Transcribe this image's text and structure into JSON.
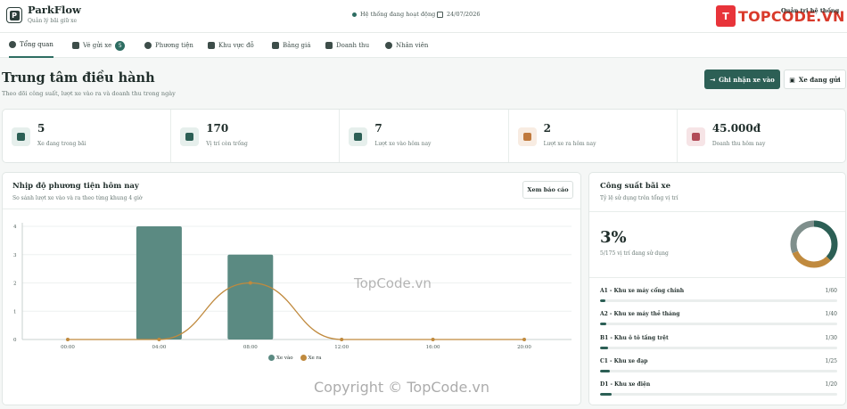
{
  "header": {
    "app_name": "ParkFlow",
    "app_sub": "Quản lý bãi giữ xe",
    "logo_letter": "P",
    "status": "Hệ thống đang hoạt động",
    "date": "24/07/2026",
    "admin": "Quản trị hệ thống",
    "watermark_brand": "TOPCODE.VN"
  },
  "nav": {
    "tabs": [
      {
        "label": "Tổng quan"
      },
      {
        "label": "Vé gửi xe",
        "badge": "5"
      },
      {
        "label": "Phương tiện"
      },
      {
        "label": "Khu vực đỗ"
      },
      {
        "label": "Bảng giá"
      },
      {
        "label": "Doanh thu"
      },
      {
        "label": "Nhân viên"
      }
    ]
  },
  "page": {
    "title": "Trung tâm điều hành",
    "subtitle": "Theo dõi công suất, lượt xe vào ra và doanh thu trong ngày",
    "primary_button": "Ghi nhận xe vào",
    "secondary_button": "Xe đang gửi"
  },
  "stats": [
    {
      "value": "5",
      "label": "Xe đang trong bãi"
    },
    {
      "value": "170",
      "label": "Vị trí còn trống"
    },
    {
      "value": "7",
      "label": "Lượt xe vào hôm nay"
    },
    {
      "value": "2",
      "label": "Lượt xe ra hôm nay"
    },
    {
      "value": "45.000đ",
      "label": "Doanh thu hôm nay"
    }
  ],
  "traffic": {
    "title": "Nhịp độ phương tiện hôm nay",
    "subtitle": "So sánh lượt xe vào và ra theo từng khung 4 giờ",
    "report_button": "Xem báo cáo"
  },
  "chart_data": {
    "type": "bar",
    "categories": [
      "00:00",
      "04:00",
      "08:00",
      "12:00",
      "16:00",
      "20:00"
    ],
    "ylim": [
      0,
      4
    ],
    "yticks": [
      "0",
      "1",
      "2",
      "3",
      "4"
    ],
    "series": [
      {
        "name": "Xe vào",
        "type": "bar",
        "color": "#5b8a82",
        "values": [
          0,
          4,
          3,
          0,
          0,
          0
        ]
      },
      {
        "name": "Xe ra",
        "type": "line",
        "color": "#c08a3e",
        "values": [
          0,
          0,
          2,
          0,
          0,
          0
        ]
      }
    ]
  },
  "capacity": {
    "title": "Công suất bãi xe",
    "subtitle": "Tỷ lệ sử dụng trên tổng vị trí",
    "percent": "3%",
    "detail": "5/175 vị trí đang sử dụng",
    "donut_colors": [
      "#2c5f55",
      "#c08a3e",
      "#7f8f8c"
    ],
    "zones": [
      {
        "name": "A1 - Khu xe máy cổng chính",
        "cap": "1/60",
        "ratio": 0.0167
      },
      {
        "name": "A2 - Khu xe máy thẻ tháng",
        "cap": "1/40",
        "ratio": 0.025
      },
      {
        "name": "B1 - Khu ô tô tầng trệt",
        "cap": "1/30",
        "ratio": 0.0333
      },
      {
        "name": "C1 - Khu xe đạp",
        "cap": "1/25",
        "ratio": 0.04
      },
      {
        "name": "D1 - Khu xe điện",
        "cap": "1/20",
        "ratio": 0.05
      }
    ]
  },
  "watermarks": {
    "middle": "TopCode.vn",
    "bottom": "Copyright © TopCode.vn"
  }
}
